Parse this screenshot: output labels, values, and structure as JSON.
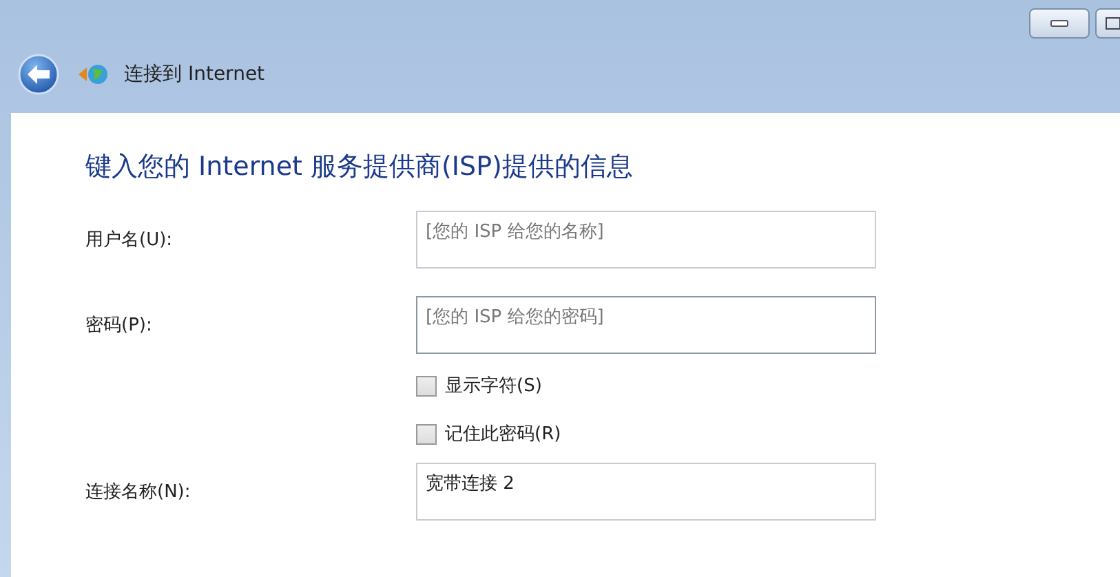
{
  "window": {
    "title": "连接到 Internet"
  },
  "heading": "键入您的 Internet 服务提供商(ISP)提供的信息",
  "fields": [
    {
      "label": "用户名(U):",
      "placeholder": "[您的 ISP 给您的名称]"
    },
    {
      "label": "密码(P):",
      "placeholder": "[您的 ISP 给您的密码]"
    }
  ],
  "checkboxes": [
    {
      "label": "显示字符(S)",
      "checked": false
    },
    {
      "label": "记住此密码(R)",
      "checked": false
    }
  ],
  "connection_name": {
    "label": "连接名称(N):",
    "value": "宽带连接 2"
  }
}
